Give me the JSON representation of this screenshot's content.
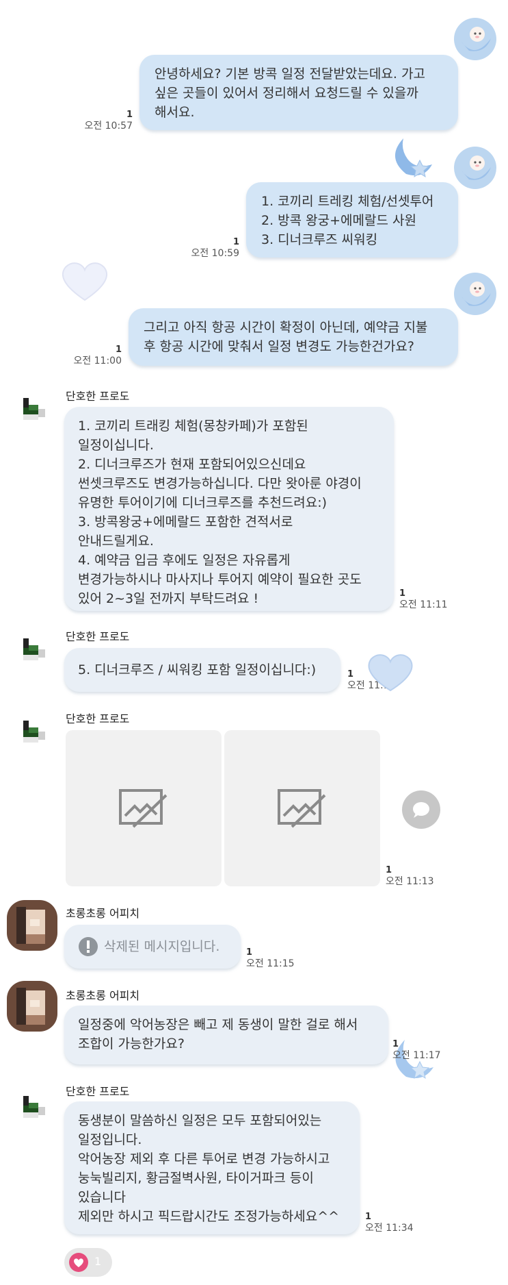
{
  "messages": [
    {
      "lines": [
        "안녕하세요? 기본 방콕 일정 전달받았는데요. 가고",
        "싶은 곳들이 있어서 정리해서 요청드릴 수 있을까",
        "해서요."
      ],
      "read": "1",
      "time": "오전 10:57"
    },
    {
      "lines": [
        "1. 코끼리 트레킹 체험/선셋투어",
        "2. 방콕 왕궁+에메랄드 사원",
        "3. 디너크루즈 씨워킹"
      ],
      "read": "1",
      "time": "오전 10:59"
    },
    {
      "lines": [
        "그리고 아직 항공 시간이 확정이 아닌데, 예약금 지불",
        "후 항공 시간에 맞춰서 일정 변경도 가능한건가요?"
      ],
      "read": "1",
      "time": "오전 11:00"
    },
    {
      "sender": "단호한 프로도",
      "lines": [
        "1. 코끼리 트래킹 체험(몽창카페)가 포함된",
        "일정이십니다.",
        "2. 디너크루즈가 현재 포함되어있으신데요",
        "썬셋크루즈도 변경가능하십니다. 다만 왓아룬 야경이",
        "유명한 투어이기에 디너크루즈를 추천드려요:)",
        "3. 방콕왕궁+에메랄드 포함한 견적서로",
        "안내드릴게요.",
        "4. 예약금 입금 후에도 일정은 자유롭게",
        "변경가능하시나 마사지나 투어지 예약이 필요한 곳도",
        "있어 2~3일 전까지 부탁드려요 !"
      ],
      "read": "1",
      "time": "오전 11:11"
    },
    {
      "sender": "단호한 프로도",
      "lines": [
        "5. 디너크루즈 / 씨워킹 포함 일정이십니다:)"
      ],
      "read": "1",
      "time": "오전 11:12"
    },
    {
      "sender": "단호한 프로도",
      "read": "1",
      "time": "오전 11:13"
    },
    {
      "sender": "초롱초롱 어피치",
      "lines": [
        "삭제된 메시지입니다."
      ],
      "read": "1",
      "time": "오전 11:15"
    },
    {
      "sender": "초롱초롱 어피치",
      "lines": [
        "일정중에 악어농장은 빼고 제 동생이 말한 걸로 해서",
        "조합이 가능한가요?"
      ],
      "read": "1",
      "time": "오전 11:17"
    },
    {
      "sender": "단호한 프로도",
      "lines": [
        "동생분이 말씀하신 일정은 모두 포함되어있는",
        "일정입니다.",
        "악어농장 제외 후 다른 투어로 변경 가능하시고",
        "눙눅빌리지, 황금절벽사원, 타이거파크 등이",
        "있습니다",
        "제외만 하시고 픽드랍시간도 조정가능하세요^^"
      ],
      "read": "1",
      "time": "오전 11:34"
    }
  ],
  "reaction": {
    "count": "1"
  },
  "colors": {
    "my_bubble": "#d3e5f6",
    "other_bubble": "#e9eff6",
    "heart": "#e64c7c"
  }
}
